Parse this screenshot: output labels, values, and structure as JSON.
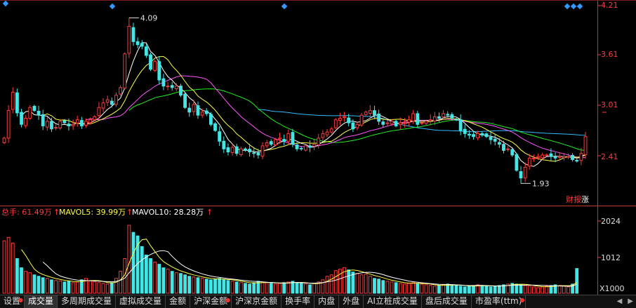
{
  "price_axis": {
    "labels": [
      "4.21",
      "3.61",
      "3.01",
      "2.41"
    ]
  },
  "volume_axis": {
    "labels": [
      "2024",
      "1012",
      "X1000"
    ]
  },
  "annotations": {
    "high": "4.09",
    "low": "1.93",
    "finance": "财报",
    "rise": "涨"
  },
  "volume_legend": {
    "total": "总手: 61.49万",
    "ma5": "MAVOL5: 39.99万",
    "ma10": "MAVOL10: 28.28万"
  },
  "colors": {
    "up": "#ff3a3a",
    "down": "#44e5e5",
    "ma5": "#ffffff",
    "ma10": "#ffff44",
    "ma20": "#ff55ff",
    "ma30": "#22ee22",
    "ma60": "#33bbff",
    "marker": "#3399ff"
  },
  "tabs": [
    {
      "label": "设置",
      "dot": true
    },
    {
      "label": "成交量",
      "dot": false,
      "active": true
    },
    {
      "label": "多周期成交量",
      "dot": false
    },
    {
      "label": "虚拟成交量",
      "dot": false
    },
    {
      "label": "金额",
      "dot": false
    },
    {
      "label": "沪深金额",
      "dot": true
    },
    {
      "label": "沪深京金额",
      "dot": false
    },
    {
      "label": "换手率",
      "dot": false
    },
    {
      "label": "内盘",
      "dot": false
    },
    {
      "label": "外盘",
      "dot": false
    },
    {
      "label": "AI立桩成交量",
      "dot": false
    },
    {
      "label": "盘后成交量",
      "dot": false
    },
    {
      "label": "市盈率(ttm)",
      "dot": true
    }
  ],
  "chart_data": {
    "type": "candlestick",
    "price_ylim": [
      1.75,
      4.25
    ],
    "volume_ylim": [
      0,
      2100
    ],
    "volume_unit": "X1000",
    "high_annotation": {
      "value": 4.09,
      "index": 29
    },
    "low_annotation": {
      "value": 1.93,
      "index": 120
    },
    "closes": [
      2.52,
      2.88,
      3.12,
      2.85,
      2.7,
      2.78,
      2.92,
      2.88,
      2.82,
      2.68,
      2.74,
      2.64,
      2.66,
      2.74,
      2.72,
      2.68,
      2.7,
      2.76,
      2.68,
      2.74,
      2.76,
      2.8,
      2.92,
      2.98,
      3.02,
      2.96,
      3.08,
      3.18,
      3.62,
      3.98,
      3.78,
      3.74,
      3.72,
      3.6,
      3.42,
      3.52,
      3.28,
      3.2,
      3.2,
      3.18,
      3.2,
      3.08,
      2.92,
      2.86,
      2.96,
      2.82,
      2.86,
      2.84,
      2.7,
      2.62,
      2.48,
      2.38,
      2.34,
      2.4,
      2.32,
      2.38,
      2.36,
      2.34,
      2.32,
      2.3,
      2.42,
      2.46,
      2.44,
      2.5,
      2.52,
      2.48,
      2.58,
      2.44,
      2.38,
      2.38,
      2.42,
      2.4,
      2.44,
      2.52,
      2.58,
      2.6,
      2.64,
      2.76,
      2.78,
      2.8,
      2.72,
      2.64,
      2.7,
      2.82,
      2.86,
      2.88,
      2.82,
      2.74,
      2.7,
      2.72,
      2.74,
      2.68,
      2.72,
      2.72,
      2.76,
      2.84,
      2.7,
      2.72,
      2.74,
      2.76,
      2.8,
      2.78,
      2.84,
      2.82,
      2.78,
      2.76,
      2.62,
      2.58,
      2.56,
      2.54,
      2.58,
      2.56,
      2.54,
      2.5,
      2.48,
      2.44,
      2.36,
      2.38,
      2.3,
      2.1,
      2.0,
      2.14,
      2.26,
      2.26,
      2.28,
      2.3,
      2.3,
      2.28,
      2.26,
      2.28,
      2.28,
      2.28,
      2.24,
      2.22,
      2.32,
      2.54
    ],
    "volume": [
      1480,
      1580,
      1420,
      980,
      720,
      620,
      580,
      520,
      480,
      440,
      420,
      380,
      360,
      350,
      320,
      340,
      300,
      320,
      380,
      420,
      360,
      320,
      300,
      280,
      260,
      300,
      420,
      620,
      980,
      1920,
      1720,
      1620,
      1320,
      1080,
      980,
      880,
      820,
      720,
      680,
      620,
      580,
      560,
      520,
      480,
      460,
      440,
      420,
      400,
      380,
      400,
      420,
      380,
      360,
      340,
      320,
      300,
      280,
      260,
      300,
      340,
      320,
      300,
      280,
      260,
      280,
      300,
      320,
      340,
      300,
      280,
      260,
      240,
      280,
      320,
      380,
      480,
      520,
      640,
      680,
      720,
      660,
      600,
      560,
      520,
      540,
      480,
      420,
      400,
      360,
      340,
      320,
      300,
      280,
      260,
      280,
      300,
      280,
      260,
      240,
      220,
      200,
      220,
      240,
      260,
      240,
      220,
      200,
      180,
      200,
      220,
      240,
      220,
      200,
      180,
      200,
      220,
      240,
      260,
      280,
      260,
      240,
      220,
      200,
      180,
      160,
      180,
      200,
      220,
      240,
      220,
      200,
      180,
      260,
      700
    ]
  }
}
